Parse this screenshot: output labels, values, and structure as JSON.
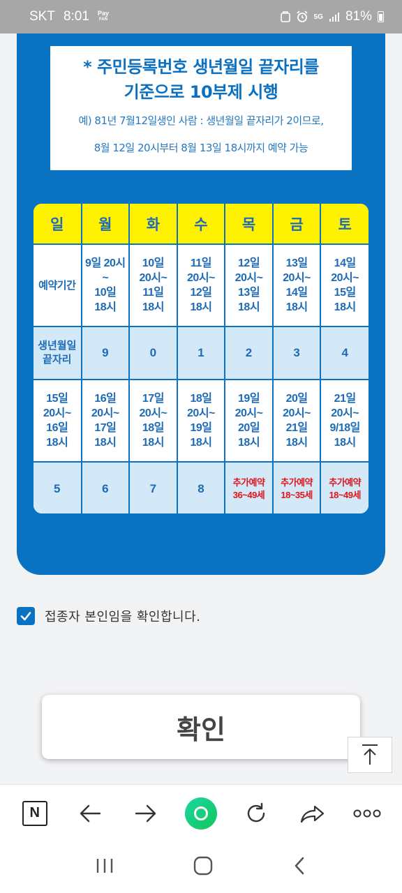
{
  "status_bar": {
    "carrier": "SKT",
    "time": "8:01",
    "pay_label": "Pay",
    "pay_sub": "FAN",
    "signal_label": "5G",
    "battery": "81%"
  },
  "notice": {
    "title_line1": "* 주민등록번호 생년월일 끝자리를",
    "title_line2": "기준으로 10부제 시행",
    "example": "예) 81년 7월12일생인 사람 : 생년월일 끝자리가 2이므로,",
    "range": "8월 12일 20시부터 8월 13일 18시까지 예약 가능"
  },
  "schedule": {
    "days": [
      "일",
      "월",
      "화",
      "수",
      "목",
      "금",
      "토"
    ],
    "week1_label": "예약기간",
    "week1_periods": [
      "9일 20시\n~\n10일\n18시",
      "10일\n20시~\n11일\n18시",
      "11일\n20시~\n12일\n18시",
      "12일\n20시~\n13일\n18시",
      "13일\n20시~\n14일\n18시",
      "14일\n20시~\n15일\n18시"
    ],
    "digit_label": "생년월일\n끝자리",
    "week1_digits": [
      "9",
      "0",
      "1",
      "2",
      "3",
      "4"
    ],
    "week2_periods": [
      "15일\n20시~\n16일\n18시",
      "16일\n20시~\n17일\n18시",
      "17일\n20시~\n18일\n18시",
      "18일\n20시~\n19일\n18시",
      "19일\n20시~\n20일\n18시",
      "20일\n20시~\n21일\n18시",
      "21일\n20시~\n9/18일\n18시"
    ],
    "week2_digits": [
      "5",
      "6",
      "7",
      "8"
    ],
    "week2_extra": [
      "추가예약\n36~49세",
      "추가예약\n18~35세",
      "추가예약\n18~49세"
    ]
  },
  "confirm_check_label": "접종자 본인임을 확인합니다.",
  "confirm_button_label": "확인",
  "colors": {
    "brand_blue": "#0a72c3",
    "header_yellow": "#fff200",
    "highlight_red": "#e0141c"
  }
}
